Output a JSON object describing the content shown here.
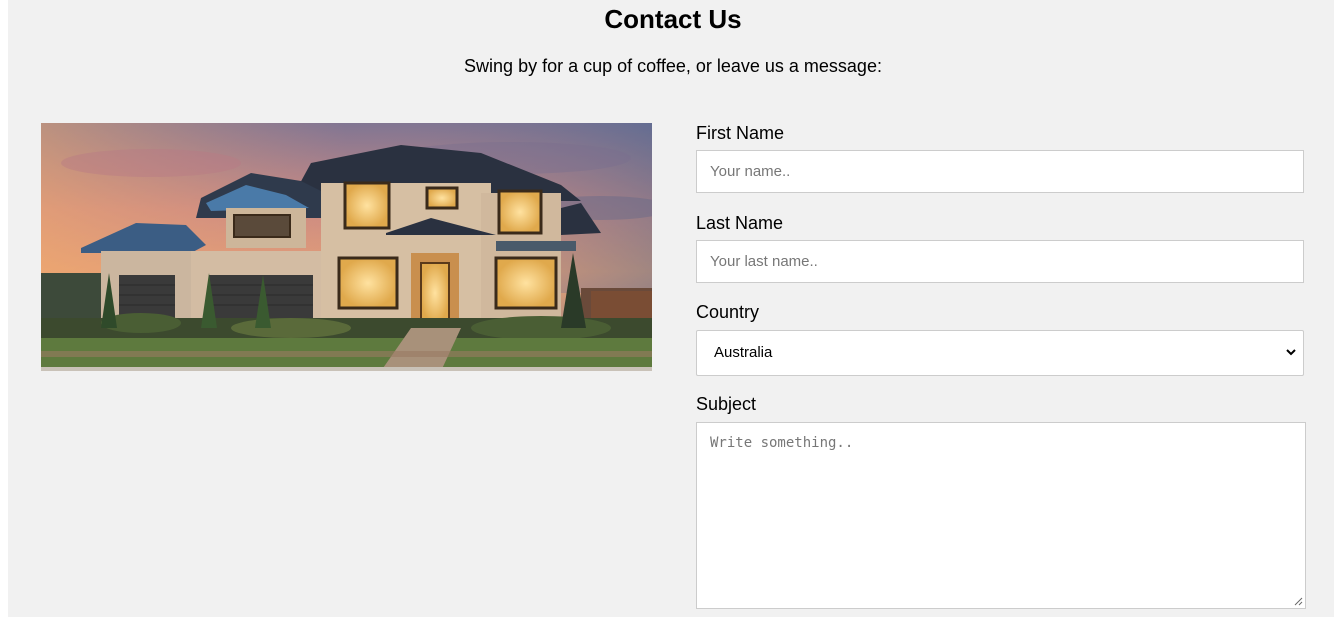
{
  "header": {
    "title": "Contact Us",
    "subtitle": "Swing by for a cup of coffee, or leave us a message:"
  },
  "form": {
    "first_name": {
      "label": "First Name",
      "placeholder": "Your name.."
    },
    "last_name": {
      "label": "Last Name",
      "placeholder": "Your last name.."
    },
    "country": {
      "label": "Country",
      "selected": "Australia"
    },
    "subject": {
      "label": "Subject",
      "placeholder": "Write something.."
    }
  },
  "colors": {
    "page_background": "#f1f1f1",
    "field_border": "#cccccc",
    "placeholder_text": "#777777"
  },
  "icons": {
    "select_arrow": "chevron-down-icon",
    "resize_handle": "resize-grip-icon"
  }
}
